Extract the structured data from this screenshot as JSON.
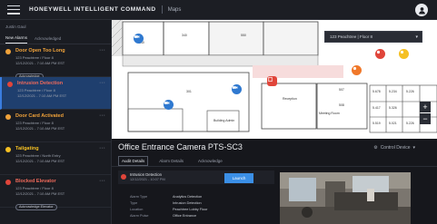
{
  "header": {
    "brand": "HONEYWELL INTELLIGENT COMMAND",
    "section": "Maps"
  },
  "sidebar": {
    "heading": "Justin Gaul",
    "tabs": [
      {
        "label": "New Alarms"
      },
      {
        "label": "Acknowledged"
      }
    ],
    "alarms": [
      {
        "title": "Door Open Too Long",
        "lines": [
          "123 Peachtree / Floor 8",
          "12/12/2021 - 7:10 AM PM EST"
        ],
        "pill": "Acknowledge",
        "color": "#f0a23a",
        "severity": "orange"
      },
      {
        "title": "Intrusion Detection",
        "lines": [
          "123 Peachtree / Floor 8",
          "12/12/2021 - 7:10 AM PM EST"
        ],
        "pill": "",
        "color": "#e0453a",
        "severity": "red"
      },
      {
        "title": "Door Card Activated",
        "lines": [
          "123 Peachtree / Floor 8",
          "12/12/2021 - 7:10 AM PM EST"
        ],
        "pill": "",
        "color": "#f0a23a",
        "severity": "orange"
      },
      {
        "title": "Tailgating",
        "lines": [
          "123 Peachtree / North Entry",
          "12/12/2021 - 7:10 AM PM EST"
        ],
        "pill": "",
        "color": "#f5c023",
        "severity": "orange"
      },
      {
        "title": "Blocked Elevator",
        "lines": [
          "123 Peachtree / Floor 8",
          "12/12/2021 - 7:10 AM PM EST"
        ],
        "pill": "Acknowledge Elevator",
        "color": "#e0453a",
        "severity": "red"
      }
    ]
  },
  "map": {
    "floor_select": "123 Peachtree | Floor 8",
    "rooms": [
      "240",
      "340",
      "550",
      "301",
      "Reception",
      "Building Admin",
      "507",
      "Meeting Room",
      "508",
      "5.678",
      "5.234",
      "5.226",
      "5.417",
      "5.326",
      "5.519",
      "5.021",
      "5.226"
    ],
    "markers": [
      {
        "kind": "camera",
        "color": "#2f79d0"
      },
      {
        "kind": "camera",
        "color": "#2f79d0"
      },
      {
        "kind": "camera",
        "color": "#2f79d0"
      },
      {
        "kind": "door",
        "color": "#e0453a"
      },
      {
        "kind": "alarm",
        "color": "#e0453a"
      },
      {
        "kind": "alarm",
        "color": "#f0782a"
      },
      {
        "kind": "alarm",
        "color": "#f5c023"
      }
    ]
  },
  "detail": {
    "title": "Office Entrance Camera PTS-SC3",
    "control_label": "Control Device",
    "tabs": [
      {
        "label": "Audit Details"
      },
      {
        "label": "Alarm Details"
      },
      {
        "label": "Acknowledge"
      }
    ],
    "event": {
      "title": "Intrusion Detection",
      "time": "12/12/2021 - 10:07 PM"
    },
    "ack_label": "Launch",
    "rows": [
      {
        "label": "Alarm Type",
        "value": "Analytics Detection"
      },
      {
        "label": "Type",
        "value": "Intrusion Detection"
      },
      {
        "label": "Location",
        "value": "Peachtree Lobby Floor"
      },
      {
        "label": "Alarm Pulse",
        "value": "Office Entrance"
      }
    ]
  }
}
